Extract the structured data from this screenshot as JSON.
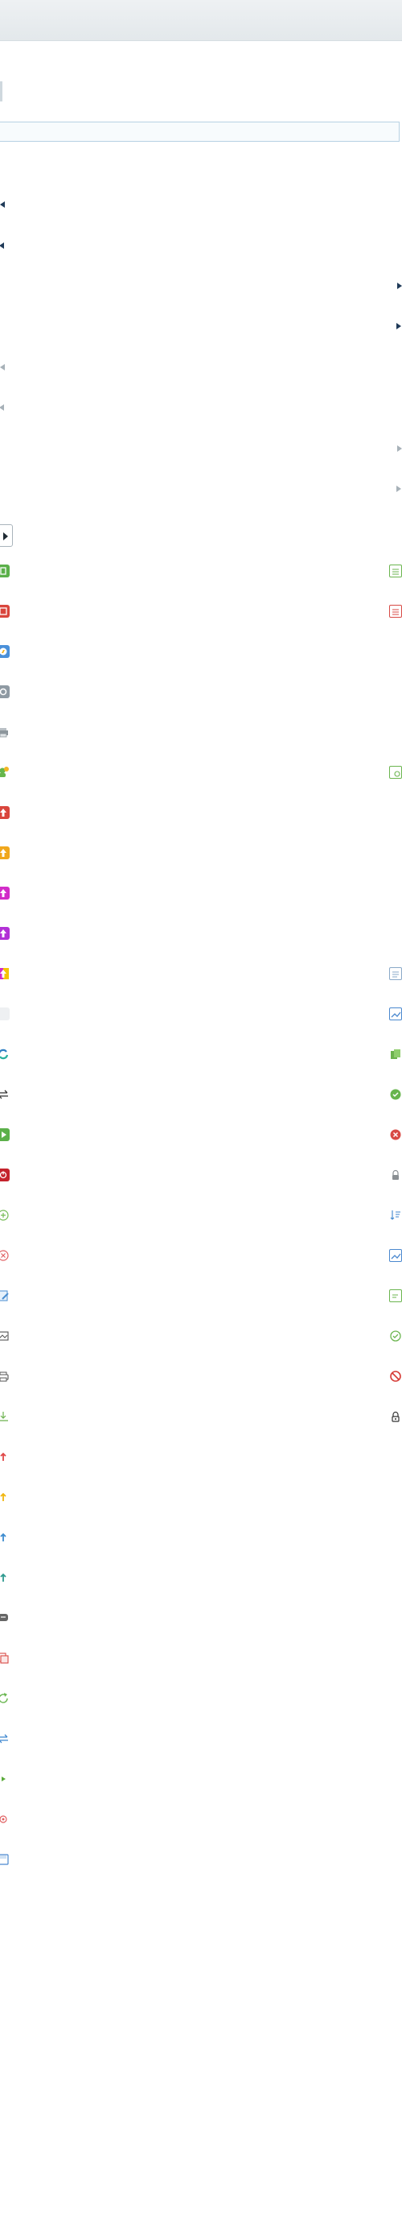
{
  "search": {
    "value": "",
    "placeholder": ""
  },
  "colors": {
    "nav_dark": "#1f3a58",
    "nav_disabled": "#a7b1b8",
    "green": "#5bb04a",
    "red": "#d9463d",
    "blue": "#4a90d9",
    "orange": "#f0a71c",
    "magenta": "#d22cc8",
    "purple": "#b230d6"
  },
  "left_icons": [
    "first-page-icon",
    "previous-page-icon",
    "first-page-disabled-icon",
    "previous-page-disabled-icon",
    "play-button-icon",
    "excel-export-icon",
    "pdf-export-icon",
    "safari-icon",
    "camera-icon",
    "printer-icon",
    "add-user-icon",
    "upload-red-icon",
    "upload-orange-icon",
    "upload-magenta-icon",
    "upload-purple-icon",
    "upload-multicolor-icon",
    "blank-icon",
    "refresh-icon",
    "swap-icon",
    "play-icon",
    "power-icon",
    "add-circle-icon",
    "cancel-circle-icon",
    "edit-document-icon",
    "image-icon",
    "print-icon",
    "download-icon",
    "arrow-up-red-icon",
    "arrow-up-yellow-icon",
    "arrow-up-blue-icon",
    "arrow-up-teal-icon",
    "chat-icon",
    "documents-red-icon",
    "reload-icon",
    "exchange-icon",
    "play-small-icon",
    "stop-circle-icon",
    "save-icon"
  ],
  "right_icons": [
    "next-page-icon",
    "last-page-icon",
    "next-page-disabled-icon",
    "last-page-disabled-icon",
    "excel-outline-icon",
    "pdf-outline-icon",
    "image-edit-icon",
    "notes-icon",
    "image-blue-icon",
    "copy-green-icon",
    "check-green-icon",
    "delete-red-icon",
    "lock-icon",
    "sort-icon",
    "image-outline-blue-icon",
    "note-edit-icon",
    "check-circle-icon",
    "block-icon",
    "padlock-icon"
  ]
}
